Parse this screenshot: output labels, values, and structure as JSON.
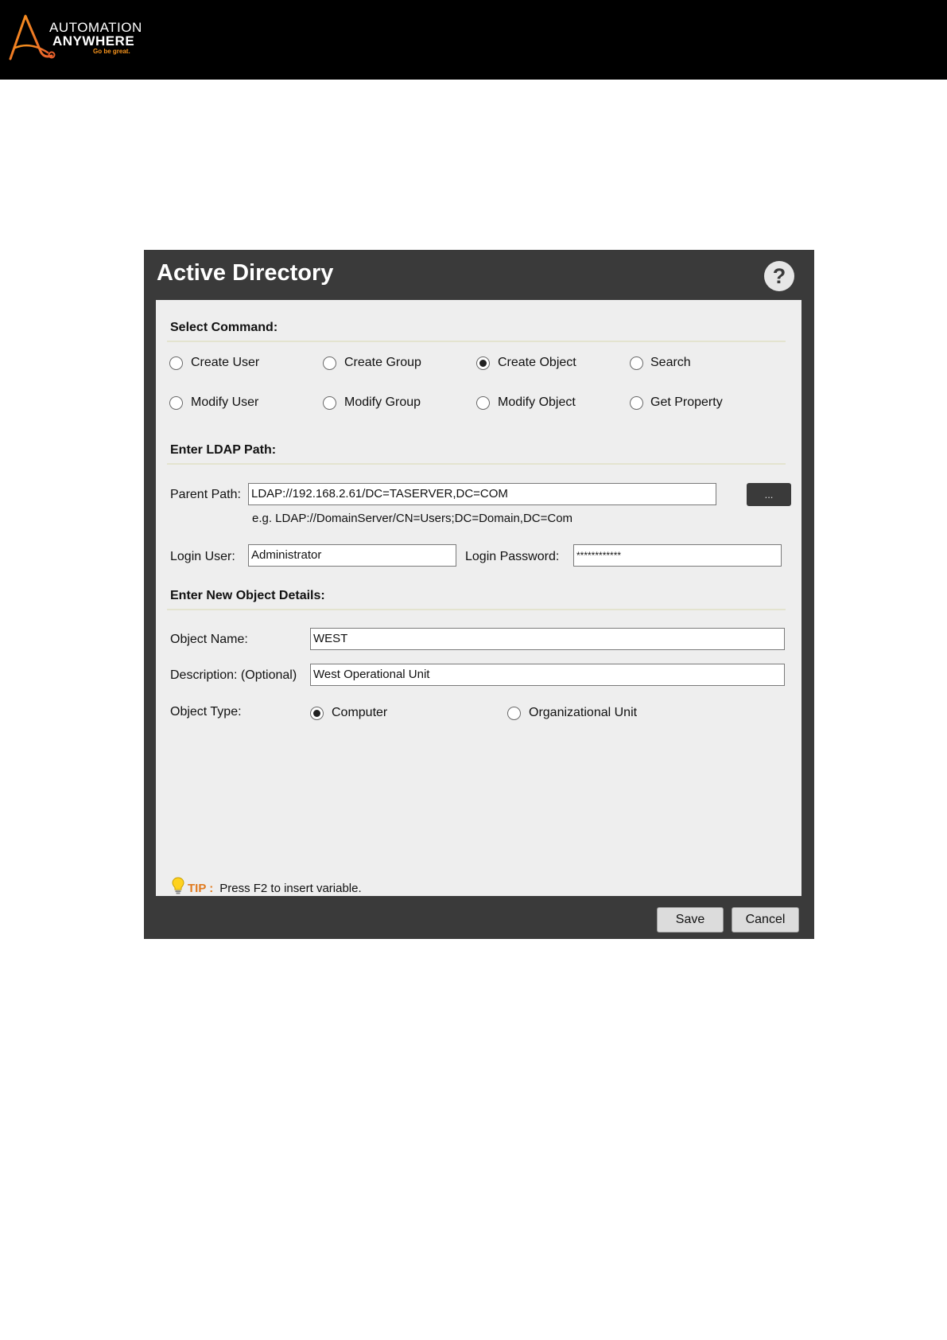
{
  "brand": {
    "line1": "AUTOMATION",
    "line2": "ANYWHERE",
    "tagline": "Go be great.",
    "accent_color": "#f7941d"
  },
  "dialog": {
    "title": "Active Directory",
    "help_label": "?",
    "select_command": {
      "title": "Select Command:",
      "options": [
        {
          "label": "Create User",
          "checked": false
        },
        {
          "label": "Create Group",
          "checked": false
        },
        {
          "label": "Create Object",
          "checked": true
        },
        {
          "label": "Search",
          "checked": false
        },
        {
          "label": "Modify User",
          "checked": false
        },
        {
          "label": "Modify Group",
          "checked": false
        },
        {
          "label": "Modify Object",
          "checked": false
        },
        {
          "label": "Get Property",
          "checked": false
        }
      ]
    },
    "ldap": {
      "title": "Enter LDAP Path:",
      "parent_path_label": "Parent Path:",
      "parent_path_value": "LDAP://192.168.2.61/DC=TASERVER,DC=COM",
      "browse_label": "...",
      "example": "e.g. LDAP://DomainServer/CN=Users;DC=Domain,DC=Com",
      "login_user_label": "Login User:",
      "login_user_value": "Administrator",
      "login_password_label": "Login Password:",
      "login_password_value": "************"
    },
    "object_details": {
      "title": "Enter New Object Details:",
      "object_name_label": "Object Name:",
      "object_name_value": "WEST",
      "description_label": "Description: (Optional)",
      "description_value": "West Operational Unit",
      "object_type_label": "Object Type:",
      "object_types": [
        {
          "label": "Computer",
          "checked": true
        },
        {
          "label": "Organizational Unit",
          "checked": false
        }
      ]
    },
    "tip": {
      "label": "TIP :",
      "text": "Press F2 to insert variable."
    },
    "buttons": {
      "save": "Save",
      "cancel": "Cancel"
    }
  }
}
